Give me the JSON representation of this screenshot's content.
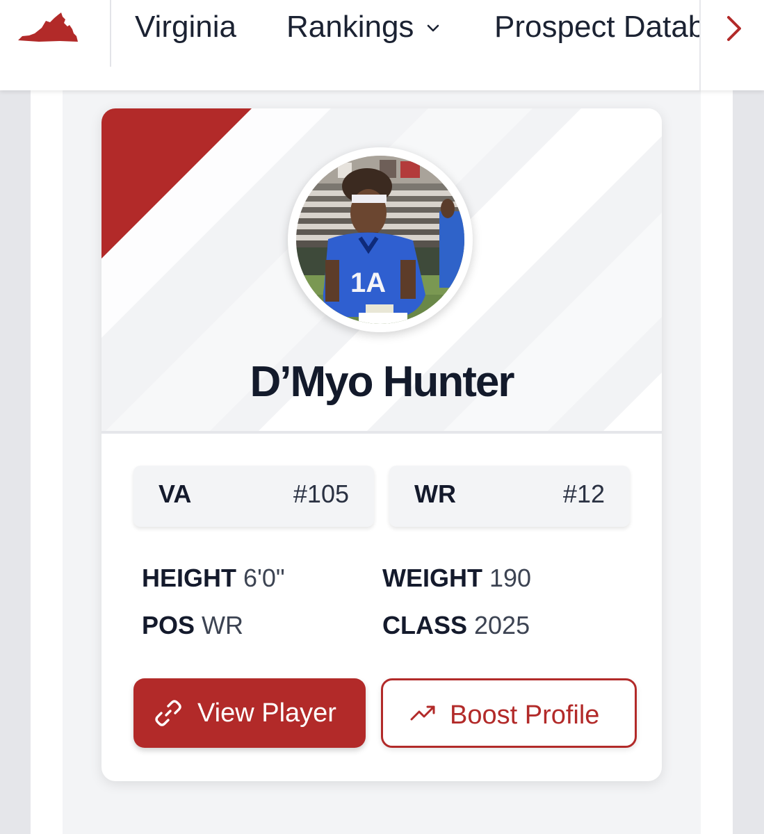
{
  "nav": {
    "brand_icon": "virginia-state-logo",
    "items": [
      {
        "label": "Virginia"
      },
      {
        "label": "Rankings",
        "icon": "chevron-down-icon"
      },
      {
        "label": "Prospect Database"
      }
    ],
    "scroll_icon": "chevron-right-icon"
  },
  "player": {
    "name": "D’Myo Hunter",
    "photo_icon": "player-photo",
    "ranks": [
      {
        "label": "VA",
        "value": "#105"
      },
      {
        "label": "WR",
        "value": "#12"
      }
    ],
    "stats": {
      "height": {
        "label": "HEIGHT",
        "value": "6'0\""
      },
      "weight": {
        "label": "WEIGHT",
        "value": "190"
      },
      "pos": {
        "label": "POS",
        "value": "WR"
      },
      "class": {
        "label": "CLASS",
        "value": "2025"
      }
    },
    "actions": {
      "view": {
        "label": "View Player",
        "icon": "link-icon"
      },
      "boost": {
        "label": "Boost Profile",
        "icon": "trending-up-icon"
      }
    }
  },
  "colors": {
    "accent": "#b22a29",
    "text": "#141a2c",
    "background": "#e5e6ea",
    "card": "#ffffff"
  }
}
